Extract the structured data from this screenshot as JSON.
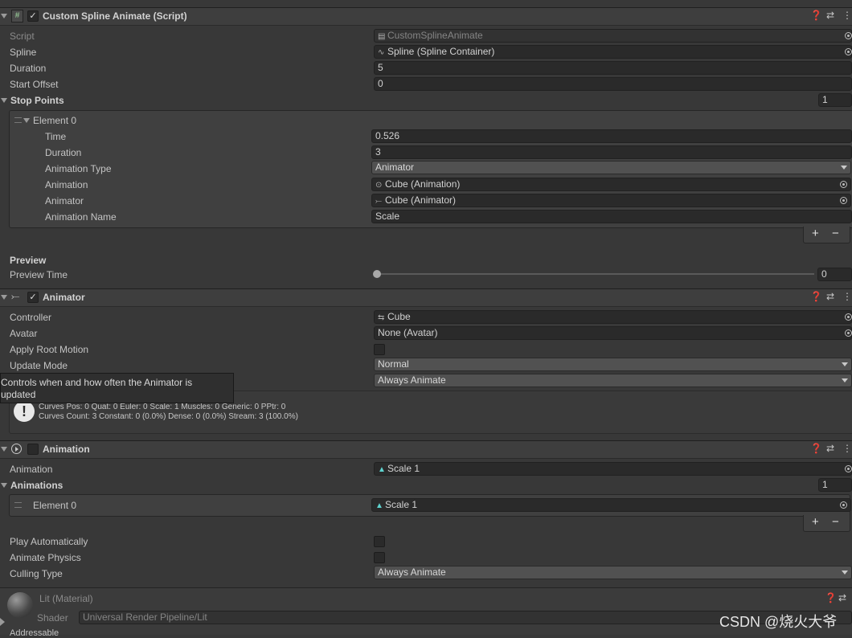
{
  "custom_spline": {
    "title": "Custom Spline Animate (Script)",
    "script_label": "Script",
    "script_value": "CustomSplineAnimate",
    "spline_label": "Spline",
    "spline_value": "Spline (Spline Container)",
    "duration_label": "Duration",
    "duration_value": "5",
    "start_offset_label": "Start Offset",
    "start_offset_value": "0",
    "stop_points_label": "Stop Points",
    "stop_points_count": "1",
    "element": {
      "label": "Element 0",
      "time_label": "Time",
      "time_value": "0.526",
      "duration_label": "Duration",
      "duration_value": "3",
      "anim_type_label": "Animation Type",
      "anim_type_value": "Animator",
      "animation_label": "Animation",
      "animation_value": "Cube (Animation)",
      "animator_label": "Animator",
      "animator_value": "Cube (Animator)",
      "anim_name_label": "Animation Name",
      "anim_name_value": "Scale"
    },
    "preview_header": "Preview",
    "preview_time_label": "Preview Time",
    "preview_time_value": "0",
    "preview_time_fraction": 0
  },
  "animator": {
    "title": "Animator",
    "controller_label": "Controller",
    "controller_value": "Cube",
    "avatar_label": "Avatar",
    "avatar_value": "None (Avatar)",
    "apply_root_label": "Apply Root Motion",
    "update_mode_label": "Update Mode",
    "update_mode_value": "Normal",
    "culling_value": "Always Animate",
    "tooltip_line1": "Controls when and how often the Animator is",
    "tooltip_line2": "updated",
    "info_line1": "Curves Pos: 0 Quat: 0 Euler: 0 Scale: 1 Muscles: 0 Generic: 0 PPtr: 0",
    "info_line2": "Curves Count: 3 Constant: 0 (0.0%) Dense: 0 (0.0%) Stream: 3 (100.0%)"
  },
  "animation": {
    "title": "Animation",
    "animation_label": "Animation",
    "animation_value": "Scale 1",
    "animations_label": "Animations",
    "animations_count": "1",
    "element_label": "Element 0",
    "element_value": "Scale 1",
    "play_auto_label": "Play Automatically",
    "animate_physics_label": "Animate Physics",
    "culling_label": "Culling Type",
    "culling_value": "Always Animate"
  },
  "material": {
    "title": "Lit (Material)",
    "shader_label": "Shader",
    "shader_value": "Universal Render Pipeline/Lit",
    "addressable_label": "Addressable"
  },
  "watermark": "CSDN @烧火大爷",
  "colors": {
    "panel_bg": "#383838",
    "header_bg": "#3e3e3e",
    "field_bg": "#2a2a2a",
    "accent_teal": "#5fd4d0"
  }
}
